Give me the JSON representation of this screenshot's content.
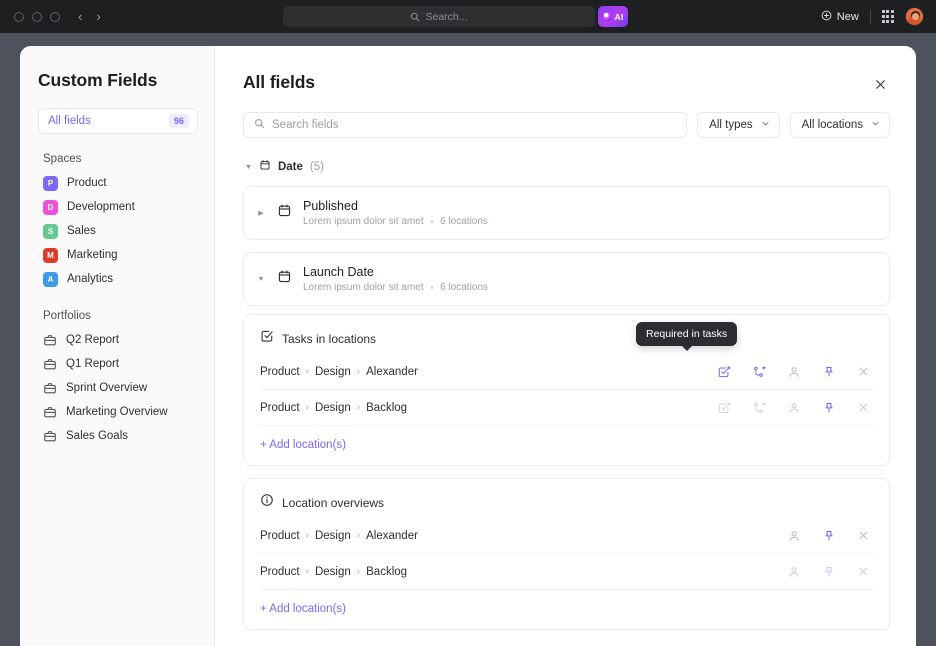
{
  "browser": {
    "traffic_lights": [
      "close",
      "minimize",
      "maximize"
    ],
    "back_arrow": "‹",
    "forward_arrow": "›",
    "search_placeholder": "Search...",
    "ai_label": "AI",
    "new_label": "New"
  },
  "sidebar": {
    "title": "Custom Fields",
    "all_fields": {
      "label": "All fields",
      "count": "96"
    },
    "spaces": {
      "heading": "Spaces",
      "items": [
        {
          "label": "Product",
          "initial": "P",
          "color": "#7b68f5"
        },
        {
          "label": "Development",
          "initial": "D",
          "color": "#f14ddb"
        },
        {
          "label": "Sales",
          "initial": "S",
          "color": "#63c892"
        },
        {
          "label": "Marketing",
          "initial": "M",
          "color": "#dc3c28"
        },
        {
          "label": "Analytics",
          "initial": "A",
          "color": "#3c9ae8"
        }
      ]
    },
    "portfolios": {
      "heading": "Portfolios",
      "items": [
        {
          "label": "Q2 Report"
        },
        {
          "label": "Q1 Report"
        },
        {
          "label": "Sprint Overview"
        },
        {
          "label": "Marketing Overview"
        },
        {
          "label": "Sales Goals"
        }
      ]
    }
  },
  "main": {
    "title": "All fields",
    "search_placeholder": "Search fields",
    "search_value": "",
    "filters": [
      {
        "label": "All types"
      },
      {
        "label": "All locations"
      }
    ],
    "group": {
      "label": "Date",
      "count": "(5)"
    },
    "fields": [
      {
        "name": "Published",
        "description": "Lorem ipsum dolor sit amet",
        "locations": "6 locations",
        "expanded": false
      },
      {
        "name": "Launch Date",
        "description": "Lorem ipsum dolor sit amet",
        "locations": "6 locations",
        "expanded": true
      }
    ],
    "tooltip": "Required in tasks",
    "panels": [
      {
        "title": "Tasks in locations",
        "icon": "checkbox-check-icon",
        "rows": [
          {
            "crumbs": [
              "Product",
              "Design",
              "Alexander"
            ],
            "actions": [
              {
                "name": "required-in-tasks-icon",
                "active": true
              },
              {
                "name": "required-in-subtasks-icon",
                "active": true
              },
              {
                "name": "person-icon",
                "active": false
              },
              {
                "name": "pin-icon",
                "active": true
              },
              {
                "name": "remove-icon",
                "active": false
              }
            ]
          },
          {
            "crumbs": [
              "Product",
              "Design",
              "Backlog"
            ],
            "actions": [
              {
                "name": "required-in-tasks-icon",
                "active": false
              },
              {
                "name": "required-in-subtasks-icon",
                "active": false
              },
              {
                "name": "person-icon",
                "active": false
              },
              {
                "name": "pin-icon",
                "active": true
              },
              {
                "name": "remove-icon",
                "active": false
              }
            ]
          }
        ],
        "add_label": "+ Add location(s)"
      },
      {
        "title": "Location overviews",
        "icon": "info-icon",
        "rows": [
          {
            "crumbs": [
              "Product",
              "Design",
              "Alexander"
            ],
            "actions": [
              {
                "name": "person-icon",
                "active": false
              },
              {
                "name": "pin-icon",
                "active": true
              },
              {
                "name": "remove-icon",
                "active": false
              }
            ]
          },
          {
            "crumbs": [
              "Product",
              "Design",
              "Backlog"
            ],
            "actions": [
              {
                "name": "person-icon",
                "active": false
              },
              {
                "name": "pin-icon",
                "active": false
              },
              {
                "name": "remove-icon",
                "active": false
              }
            ]
          }
        ],
        "add_label": "+ Add location(s)"
      }
    ]
  },
  "colors": {
    "accent": "#7b68f5",
    "desktop_bg": "#4e525c",
    "topbar_bg": "#1d1f21",
    "tooltip_bg": "#2b2d33"
  }
}
